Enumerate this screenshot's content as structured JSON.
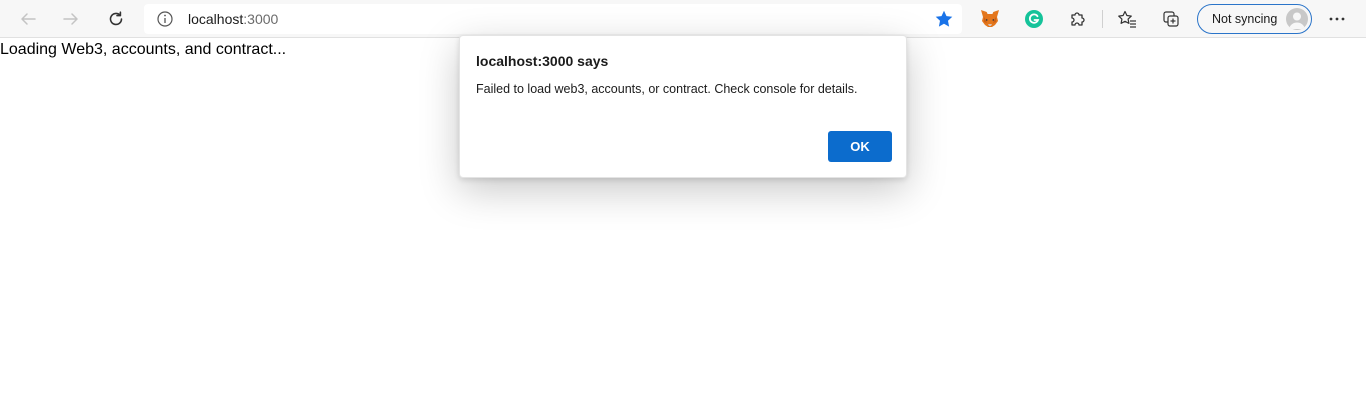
{
  "browser": {
    "url_host": "localhost",
    "url_port": ":3000",
    "profile_label": "Not syncing",
    "icons": {
      "back": "arrow-left-icon",
      "forward": "arrow-right-icon",
      "refresh": "refresh-icon",
      "site_info": "info-icon",
      "favorite": "star-filled-icon",
      "metamask": "metamask-fox-icon",
      "grammarly": "grammarly-icon",
      "extensions": "puzzle-icon",
      "favorites": "favorites-star-icon",
      "collections": "collections-icon",
      "avatar": "user-avatar-icon",
      "more": "more-dots-icon"
    },
    "colors": {
      "accent": "#0c6ccd",
      "star": "#1a73e8",
      "grammarly": "#15c39a",
      "metamask": "#e2761b"
    }
  },
  "page": {
    "body_text": "Loading Web3, accounts, and contract..."
  },
  "dialog": {
    "title": "localhost:3000 says",
    "message": "Failed to load web3, accounts, or contract. Check console for details.",
    "ok_label": "OK"
  }
}
